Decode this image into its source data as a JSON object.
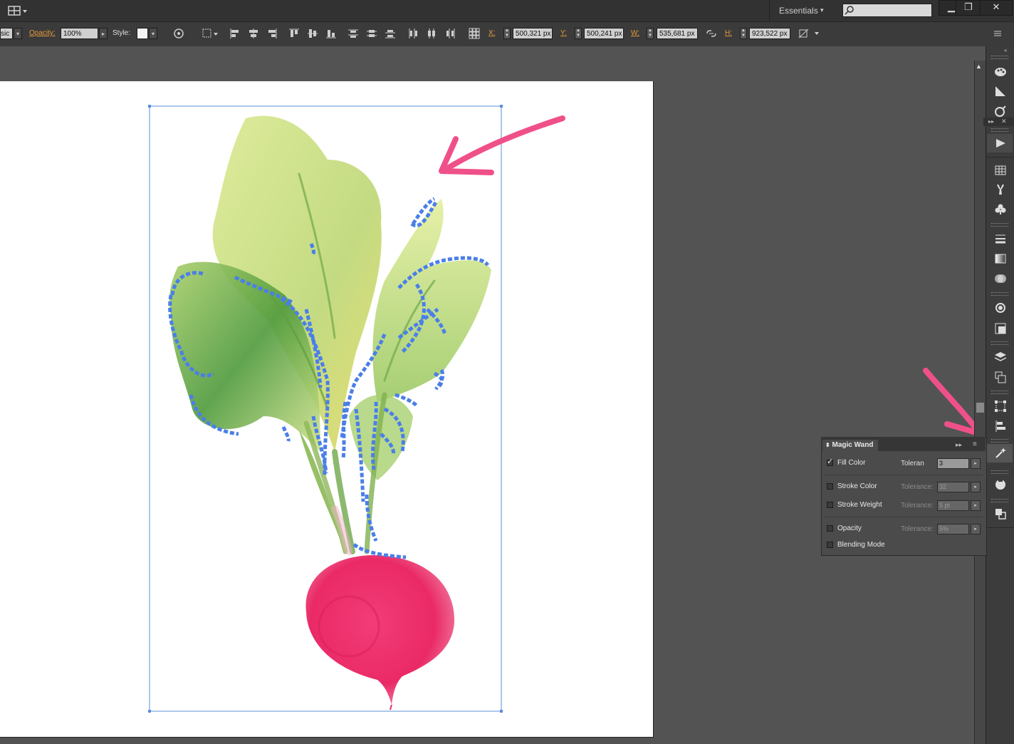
{
  "topbar": {
    "workspace": "Essentials",
    "workspace_caret": "▾",
    "search_placeholder": "",
    "window_buttons": {
      "minimize": "▁",
      "restore": "❐",
      "close": "✕"
    }
  },
  "control_bar": {
    "brush_value": "sic",
    "opacity_label": "Opacity:",
    "opacity_value": "100%",
    "style_label": "Style:",
    "x_label": "X:",
    "x_value": "500,321 px",
    "y_label": "Y:",
    "y_value": "500,241 px",
    "w_label": "W:",
    "w_value": "535,681 px",
    "h_label": "H:",
    "h_value": "923,522 px"
  },
  "artwork": {
    "subject": "Watercolor radish with green leaves",
    "selection_color": "#4a7fe8",
    "bounding_box_color": "#5b8fd9",
    "annotation_color": "#f0508a",
    "leaf_light": "#c8dd7a",
    "leaf_dark": "#5f9e3e",
    "radish_color": "#ec2f6b"
  },
  "magic_wand": {
    "title": "Magic Wand",
    "rows": [
      {
        "label": "Fill Color",
        "checked": true,
        "tolerance_label": "Toleran",
        "value": "3"
      },
      {
        "label": "Stroke Color",
        "checked": false,
        "tolerance_label": "Tolerance:",
        "value": "32"
      },
      {
        "label": "Stroke Weight",
        "checked": false,
        "tolerance_label": "Tolerance:",
        "value": "5 pt"
      },
      {
        "label": "Opacity",
        "checked": false,
        "tolerance_label": "Tolerance:",
        "value": "5%"
      },
      {
        "label": "Blending Mode",
        "checked": false
      }
    ]
  },
  "dock_icons": [
    "color-palette-icon",
    "color-guide-icon",
    "color-picker-icon",
    "play-action-icon",
    "swatches-grid-icon",
    "brushes-icon",
    "symbols-icon",
    "stroke-icon",
    "gradient-icon",
    "transparency-icon",
    "appearance-icon",
    "graphic-styles-icon",
    "layers-icon",
    "artboards-icon",
    "transform-icon",
    "align-icon",
    "magic-wand-icon",
    "navigator-icon",
    "pathfinder-icon"
  ]
}
